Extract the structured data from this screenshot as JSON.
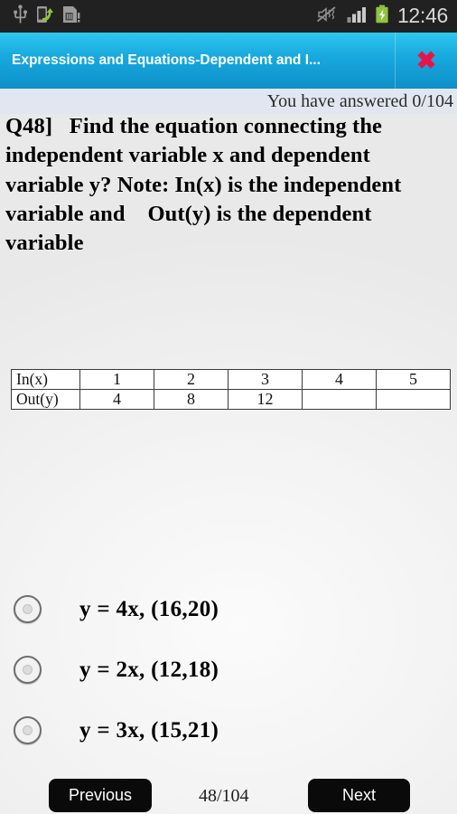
{
  "status_bar": {
    "icons_left": [
      "usb-icon",
      "usb-debugging-icon",
      "sim-card-icon"
    ],
    "icons_right": [
      "vibrate-mute-icon",
      "signal-bars-icon",
      "battery-charging-icon"
    ],
    "clock": "12:46"
  },
  "title_bar": {
    "title": "Expressions and Equations-Dependent and I...",
    "close_label": "✖",
    "background_start": "#2ec7ef",
    "background_end": "#0e8fc8",
    "close_color": "#e8134a"
  },
  "progress": {
    "answered_text": "You have answered 0/104"
  },
  "question": {
    "number": "Q48]",
    "text": "Q48]   Find the equation connecting the independent variable x and dependent variable y? Note: In(x) is the independent variable and    Out(y) is the dependent variable"
  },
  "table": {
    "rows": [
      {
        "header": "In(x)",
        "cells": [
          "1",
          "2",
          "3",
          "4",
          "5"
        ]
      },
      {
        "header": "Out(y)",
        "cells": [
          "4",
          "8",
          "12",
          "",
          ""
        ]
      }
    ]
  },
  "options": [
    {
      "label": "y = 4x,  (16,20)",
      "selected": false
    },
    {
      "label": "y = 2x,  (12,18)",
      "selected": false
    },
    {
      "label": "y = 3x,  (15,21)",
      "selected": false
    }
  ],
  "bottom_nav": {
    "previous_label": "Previous",
    "counter": "48/104",
    "next_label": "Next"
  }
}
